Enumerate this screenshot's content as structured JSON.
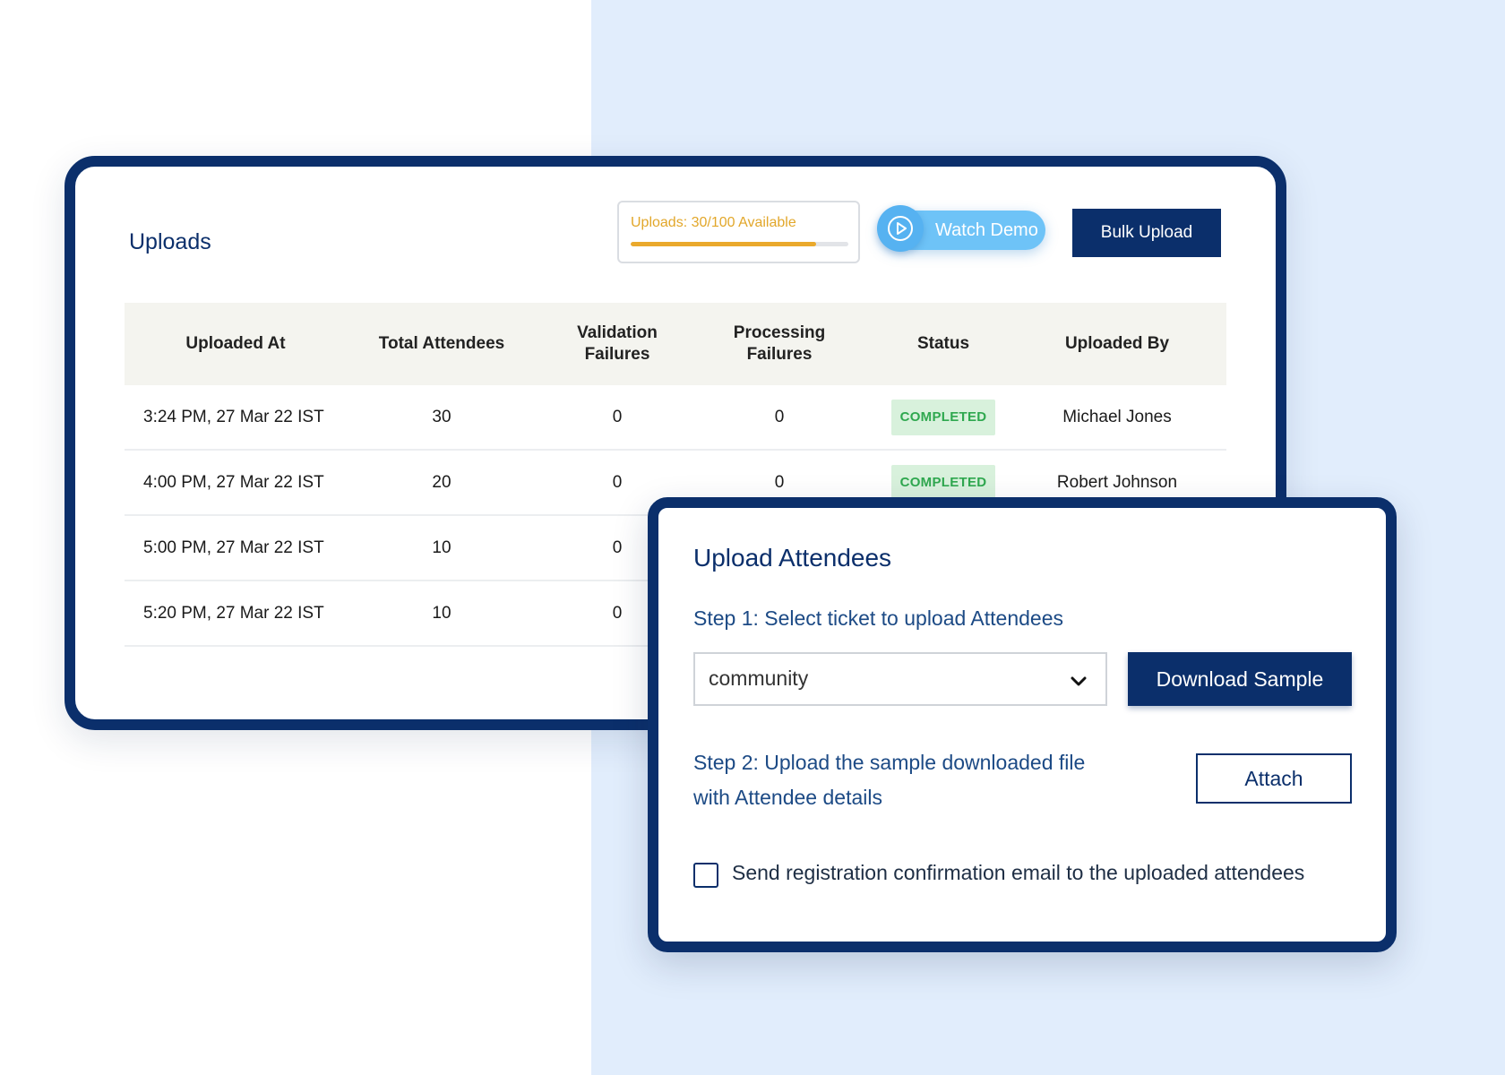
{
  "uploads": {
    "title": "Uploads",
    "quota_text": "Uploads: 30/100 Available",
    "quota_fraction": 0.85,
    "watch_demo_label": "Watch Demo",
    "bulk_upload_label": "Bulk Upload",
    "table": {
      "headers": [
        "Uploaded At",
        "Total Attendees",
        "Validation Failures",
        "Processing Failures",
        "Status",
        "Uploaded By"
      ],
      "rows": [
        {
          "uploaded_at": "3:24 PM, 27 Mar 22 IST",
          "total": "30",
          "validation": "0",
          "processing": "0",
          "status": "COMPLETED",
          "uploaded_by": "Michael Jones"
        },
        {
          "uploaded_at": "4:00 PM, 27 Mar 22 IST",
          "total": "20",
          "validation": "0",
          "processing": "0",
          "status": "COMPLETED",
          "uploaded_by": "Robert Johnson"
        },
        {
          "uploaded_at": "5:00 PM, 27 Mar 22 IST",
          "total": "10",
          "validation": "0"
        },
        {
          "uploaded_at": "5:20 PM, 27 Mar 22 IST",
          "total": "10",
          "validation": "0"
        }
      ]
    }
  },
  "attendee_panel": {
    "title": "Upload Attendees",
    "step1_label": "Step 1: Select ticket to upload Attendees",
    "ticket_selected": "community",
    "download_sample_label": "Download Sample",
    "step2_line1": "Step 2: Upload the sample downloaded file",
    "step2_line2": "with Attendee details",
    "attach_label": "Attach",
    "email_checkbox_label": "Send registration confirmation email to the uploaded attendees",
    "email_checkbox_checked": false
  },
  "colors": {
    "brand_navy": "#0b2f6b",
    "accent_blue": "#6ec3f7",
    "quota_orange": "#eaa92c",
    "success_green": "#2fa84f",
    "background_blue": "#e1edfc"
  },
  "icons": {
    "watch_demo": "play-circle-icon",
    "ticket_dropdown": "chevron-down-icon"
  }
}
